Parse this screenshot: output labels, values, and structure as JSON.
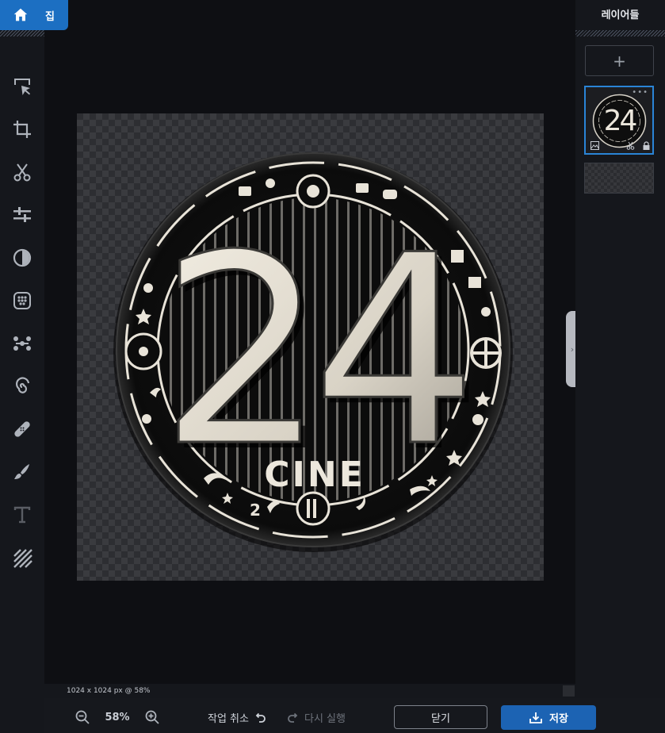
{
  "home": {
    "label": "집",
    "icon": "home-icon"
  },
  "tools": [
    {
      "name": "select-tool",
      "icon": "cursor-arrow-icon"
    },
    {
      "name": "crop-tool",
      "icon": "crop-icon"
    },
    {
      "name": "cutout-tool",
      "icon": "scissors-icon"
    },
    {
      "name": "adjust-tool",
      "icon": "sliders-icon"
    },
    {
      "name": "filter-tool",
      "icon": "contrast-circle-icon"
    },
    {
      "name": "effects-tool",
      "icon": "dots-grid-icon"
    },
    {
      "name": "liquify-tool",
      "icon": "nodes-icon"
    },
    {
      "name": "distort-tool",
      "icon": "spiral-icon"
    },
    {
      "name": "heal-tool",
      "icon": "bandage-icon"
    },
    {
      "name": "draw-tool",
      "icon": "brush-icon"
    },
    {
      "name": "text-tool",
      "icon": "text-icon"
    },
    {
      "name": "pattern-tool",
      "icon": "diagonal-lines-icon"
    }
  ],
  "canvas": {
    "status": "1024 x 1024 px @ 58%",
    "artwork": {
      "number": "24",
      "word": "CINE",
      "badge_small": "2"
    }
  },
  "bottom_bar": {
    "zoom": "58%",
    "undo_label": "작업 취소",
    "redo_label": "다시 실행",
    "close_label": "닫기",
    "save_label": "저장"
  },
  "layers_panel": {
    "title": "레이어들",
    "add_symbol": "+",
    "more_symbol": "•••"
  },
  "colors": {
    "accent": "#1c6fc2",
    "selected_border": "#2a84d6",
    "background": "#0f1014"
  }
}
